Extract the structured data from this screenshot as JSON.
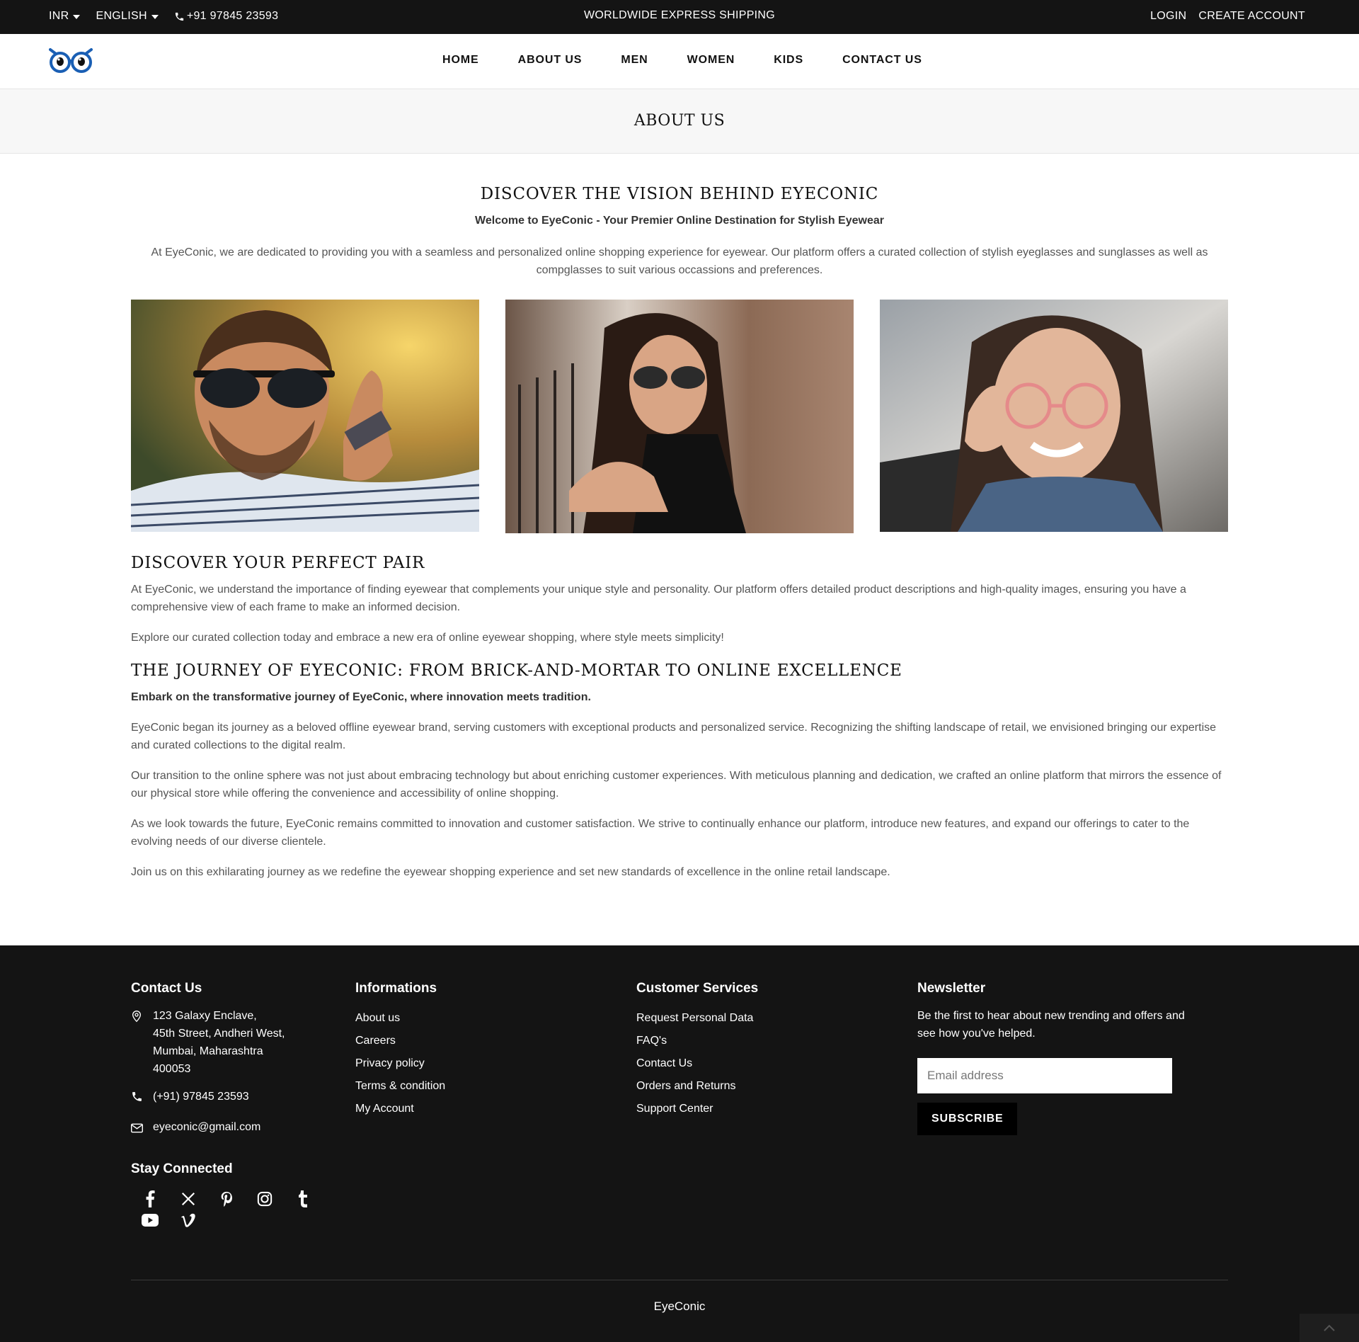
{
  "topbar": {
    "currency": "INR",
    "language": "ENGLISH",
    "phone": "+91 97845 23593",
    "promo": "WORLDWIDE EXPRESS SHIPPING",
    "login": "LOGIN",
    "create_account": "CREATE ACCOUNT"
  },
  "nav": {
    "items": [
      {
        "label": "HOME"
      },
      {
        "label": "ABOUT US"
      },
      {
        "label": "MEN"
      },
      {
        "label": "WOMEN"
      },
      {
        "label": "KIDS"
      },
      {
        "label": "CONTACT US"
      }
    ]
  },
  "page_title": "ABOUT US",
  "vision": {
    "heading": "DISCOVER THE VISION BEHIND EYECONIC",
    "subheading": "Welcome to EyeConic - Your Premier Online Destination for Stylish Eyewear",
    "intro": "At EyeConic, we are dedicated to providing you with a seamless and personalized online shopping experience for eyewear. Our platform offers a curated collection of stylish eyeglasses and sunglasses as well as compglasses to suit various occassions and preferences."
  },
  "perfect_pair": {
    "heading": "DISCOVER YOUR PERFECT PAIR",
    "p1": "At EyeConic, we understand the importance of finding eyewear that complements your unique style and personality. Our platform offers detailed product descriptions and high-quality images, ensuring you have a comprehensive view of each frame to make an informed decision.",
    "p2": "Explore our curated collection today and embrace a new era of online eyewear shopping, where style meets simplicity!"
  },
  "journey": {
    "heading": "THE JOURNEY OF EYECONIC: FROM BRICK-AND-MORTAR TO ONLINE EXCELLENCE",
    "lead": "Embark on the transformative journey of EyeConic, where innovation meets tradition.",
    "p1": "EyeConic began its journey as a beloved offline eyewear brand, serving customers with exceptional products and personalized service. Recognizing the shifting landscape of retail, we envisioned bringing our expertise and curated collections to the digital realm.",
    "p2": "Our transition to the online sphere was not just about embracing technology but about enriching customer experiences. With meticulous planning and dedication, we crafted an online platform that mirrors the essence of our physical store while offering the convenience and accessibility of online shopping.",
    "p3": "As we look towards the future, EyeConic remains committed to innovation and customer satisfaction. We strive to continually enhance our platform, introduce new features, and expand our offerings to cater to the evolving needs of our diverse clientele.",
    "p4": "Join us on this exhilarating journey as we redefine the eyewear shopping experience and set new standards of excellence in the online retail landscape."
  },
  "footer": {
    "contact": {
      "heading": "Contact Us",
      "address_lines": [
        "123 Galaxy Enclave,",
        "45th Street, Andheri West,",
        "Mumbai, Maharashtra",
        "400053"
      ],
      "phone": "(+91) 97845 23593",
      "email": "eyeconic@gmail.com"
    },
    "informations": {
      "heading": "Informations",
      "links": [
        "About us",
        "Careers",
        "Privacy policy",
        "Terms & condition",
        "My Account"
      ]
    },
    "services": {
      "heading": "Customer Services",
      "links": [
        "Request Personal Data",
        "FAQ's",
        "Contact Us",
        "Orders and Returns",
        "Support Center"
      ]
    },
    "newsletter": {
      "heading": "Newsletter",
      "text": "Be the first to hear about new trending and offers and see how you've helped.",
      "placeholder": "Email address",
      "button": "SUBSCRIBE"
    },
    "stay_connected": "Stay Connected",
    "socials": [
      "facebook-icon",
      "x-icon",
      "pinterest-icon",
      "instagram-icon",
      "tumblr-icon",
      "youtube-icon",
      "vimeo-icon"
    ],
    "copyright": "EyeConic"
  },
  "colors": {
    "topbar_bg": "#141414",
    "footer_bg": "#141414",
    "logo_blue": "#1a5fb4",
    "accent": "#000000"
  }
}
